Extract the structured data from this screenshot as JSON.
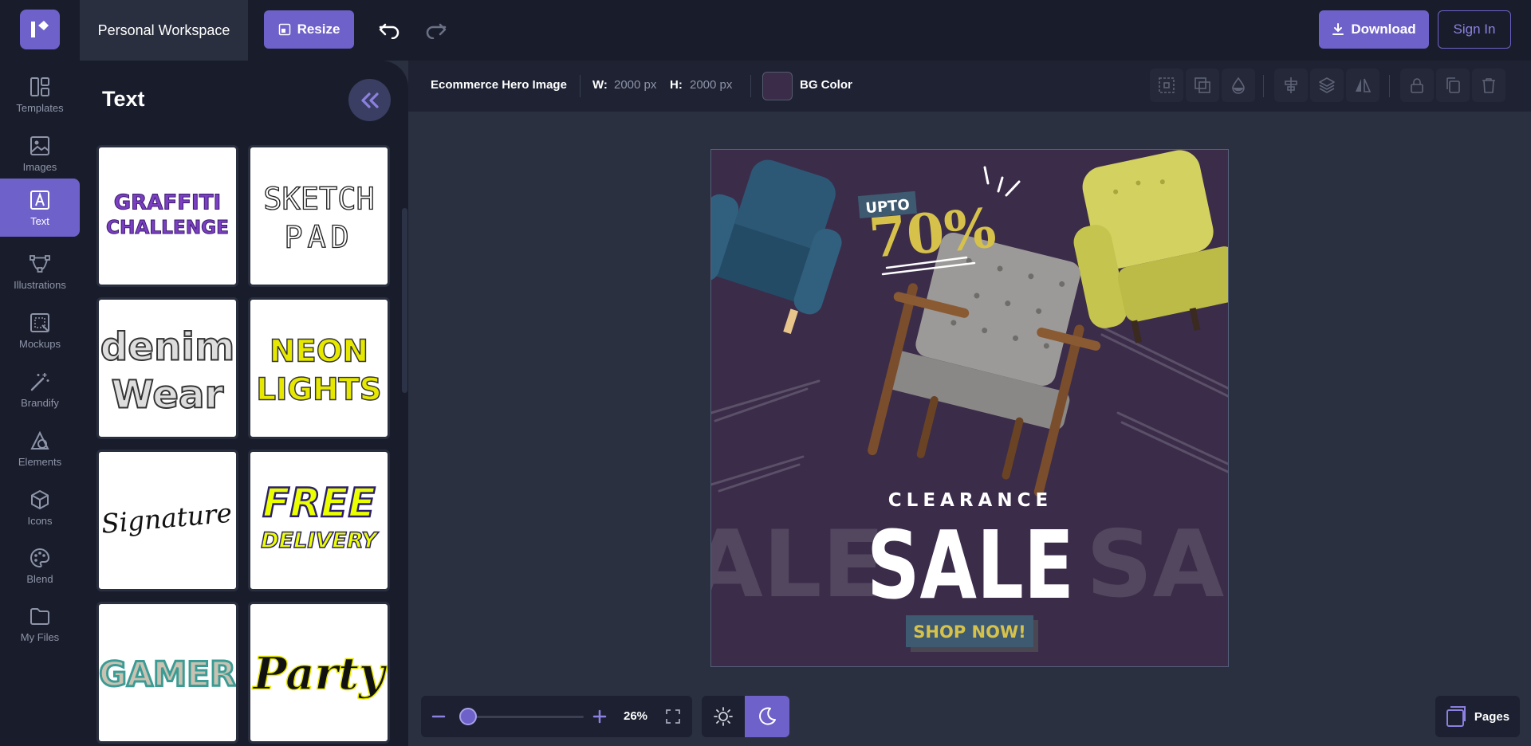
{
  "header": {
    "workspace": "Personal Workspace",
    "resize_label": "Resize",
    "download_label": "Download",
    "signin_label": "Sign In"
  },
  "sidebar": {
    "items": [
      {
        "label": "Templates",
        "icon": "templates-icon"
      },
      {
        "label": "Images",
        "icon": "image-icon"
      },
      {
        "label": "Text",
        "icon": "text-icon",
        "active": true
      },
      {
        "label": "Illustrations",
        "icon": "illustrations-icon"
      },
      {
        "label": "Mockups",
        "icon": "mockups-icon"
      },
      {
        "label": "Brandify",
        "icon": "magic-wand-icon"
      },
      {
        "label": "Elements",
        "icon": "elements-icon"
      },
      {
        "label": "Icons",
        "icon": "cube-icon"
      },
      {
        "label": "Blend",
        "icon": "palette-icon"
      },
      {
        "label": "My Files",
        "icon": "folder-icon"
      }
    ]
  },
  "panel": {
    "title": "Text",
    "tiles": [
      {
        "line1": "GRAFFITI",
        "line2": "CHALLENGE",
        "color": "#7a3fc2"
      },
      {
        "line1": "SKETCH",
        "line2": "PAD",
        "color": "#333333"
      },
      {
        "line1": "denim",
        "line2": "Wear",
        "color": "#444444"
      },
      {
        "line1": "NEON",
        "line2": "LIGHTS",
        "color": "#e6e800"
      },
      {
        "line1": "Signature",
        "line2": "",
        "color": "#111111"
      },
      {
        "line1": "FREE",
        "line2": "DELIVERY",
        "color": "#eaff00"
      },
      {
        "line1": "GAMER",
        "line2": "",
        "color": "#c9c2b2"
      },
      {
        "line1": "Party",
        "line2": "",
        "color": "#111111"
      }
    ]
  },
  "toolbar": {
    "doc_name": "Ecommerce Hero Image",
    "w_label": "W:",
    "w_value": "2000 px",
    "h_label": "H:",
    "h_value": "2000 px",
    "bg_label": "BG Color",
    "bg_color": "#3b2c4a"
  },
  "canvas": {
    "upto": "UPTO",
    "percent": "70%",
    "clearance": "CLEARANCE",
    "sale": "SALE",
    "sale_left": "ALE",
    "sale_right": "SAL",
    "cta": "SHOP NOW!"
  },
  "zoom": {
    "value": "26%",
    "level": 0.26
  },
  "pages_label": "Pages"
}
